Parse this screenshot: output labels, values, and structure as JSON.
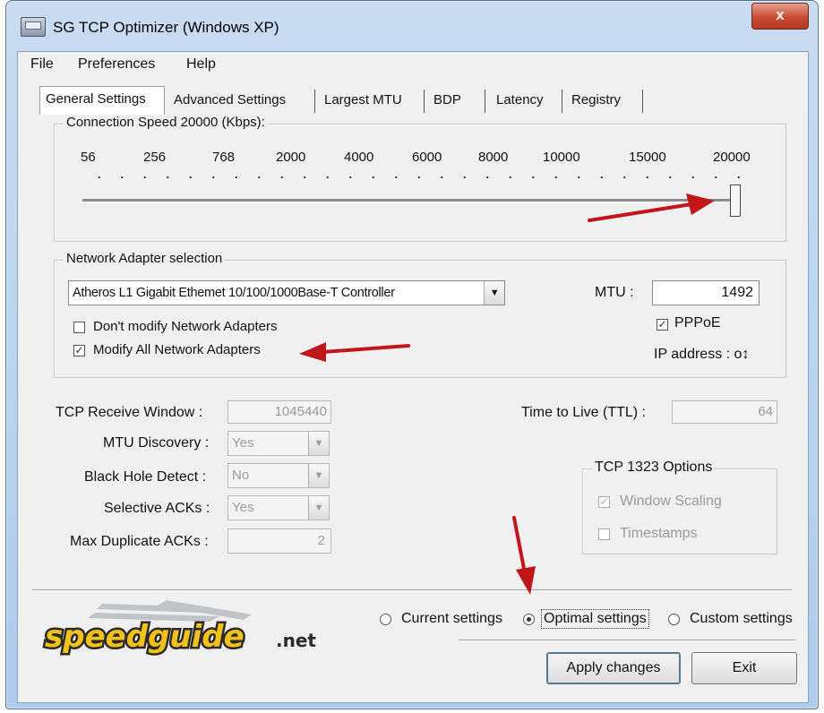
{
  "window": {
    "title": "SG TCP Optimizer (Windows XP)",
    "close_glyph": "x"
  },
  "menu": {
    "items": [
      "File",
      "Preferences",
      "Help"
    ]
  },
  "tabs": [
    "General Settings",
    "Advanced Settings",
    "Largest MTU",
    "BDP",
    "Latency",
    "Registry"
  ],
  "connection_speed": {
    "label": "Connection Speed  20000 (Kbps):",
    "ticks": [
      "56",
      "256",
      "768",
      "2000",
      "4000",
      "6000",
      "8000",
      "10000",
      "15000",
      "20000"
    ],
    "selected": "20000"
  },
  "network_adapter": {
    "group_label": "Network Adapter selection",
    "selected_adapter": "Atheros L1 Gigabit Ethemet 10/100/1000Base-T Controller",
    "mtu_label": "MTU :",
    "mtu_value": "1492",
    "pppoe_label": "PPPoE",
    "pppoe_checked": true,
    "ip_label": "IP address : o↕",
    "dont_modify_label": "Don't modify Network Adapters",
    "dont_modify_checked": false,
    "modify_all_label": "Modify All Network Adapters",
    "modify_all_checked": true
  },
  "tcp": {
    "receive_window_label": "TCP Receive Window :",
    "receive_window_value": "1045440",
    "mtu_discovery_label": "MTU Discovery :",
    "mtu_discovery_value": "Yes",
    "black_hole_label": "Black Hole Detect :",
    "black_hole_value": "No",
    "selective_acks_label": "Selective ACKs :",
    "selective_acks_value": "Yes",
    "max_dup_acks_label": "Max Duplicate ACKs :",
    "max_dup_acks_value": "2",
    "ttl_label": "Time to Live (TTL) :",
    "ttl_value": "64"
  },
  "tcp1323": {
    "group_label": "TCP 1323 Options",
    "window_scaling_label": "Window Scaling",
    "window_scaling_checked": true,
    "timestamps_label": "Timestamps",
    "timestamps_checked": false
  },
  "settings_mode": {
    "current_label": "Current settings",
    "optimal_label": "Optimal settings",
    "custom_label": "Custom settings",
    "selected": "optimal"
  },
  "buttons": {
    "apply": "Apply changes",
    "exit": "Exit"
  },
  "logo": {
    "text_main": "speedguide",
    "text_suffix": ".net"
  },
  "colors": {
    "annotation_arrow": "#c0161a",
    "logo_yellow": "#f2c21b"
  }
}
